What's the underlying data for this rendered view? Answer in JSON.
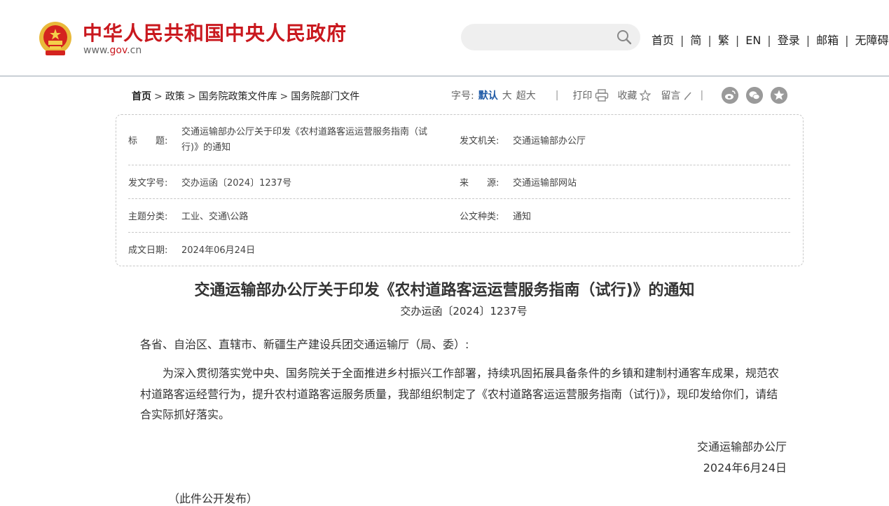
{
  "header": {
    "site_name": "中华人民共和国中央人民政府",
    "site_url_prefix": "www.",
    "site_url_highlight": "gov",
    "site_url_suffix": ".cn",
    "brand_color": "#c9181e",
    "nav": [
      "首页",
      "简",
      "繁",
      "EN",
      "登录",
      "邮箱",
      "无障碍"
    ],
    "separator": "|"
  },
  "breadcrumb": {
    "items": [
      "首页",
      "政策",
      "国务院政策文件库",
      "国务院部门文件"
    ],
    "separator": ">"
  },
  "tools": {
    "font_size_label": "字号:",
    "font_sizes": [
      "默认",
      "大",
      "超大"
    ],
    "separator": "|",
    "print_label": "打印",
    "favorite_label": "收藏",
    "comment_label": "留言",
    "share_icons": [
      "weibo-icon",
      "wechat-icon",
      "qzone-icon"
    ],
    "active_color": "#1f5aa6"
  },
  "info": {
    "title_label": "标　　题:",
    "title_line1": "交通运输部办公厅关于印发《农村道路客运运营服务指南（试",
    "title_line2": "行)》的通知",
    "issuer_label": "发文机关:",
    "issuer": "交通运输部办公厅",
    "doc_no_label": "发文字号:",
    "doc_no": "交办运函〔2024〕1237号",
    "source_label": "来　　源:",
    "source": "交通运输部网站",
    "subject_label": "主题分类:",
    "subject": "工业、交通\\公路",
    "type_label": "公文种类:",
    "type": "通知",
    "date_label": "成文日期:",
    "date": "2024年06月24日"
  },
  "article": {
    "title": "交通运输部办公厅关于印发《农村道路客运运营服务指南（试行)》的通知",
    "doc_no": "交办运函〔2024〕1237号",
    "salutation": "各省、自治区、直辖市、新疆生产建设兵团交通运输厅（局、委）:",
    "body": "为深入贯彻落实党中央、国务院关于全面推进乡村振兴工作部署，持续巩固拓展具备条件的乡镇和建制村通客车成果，规范农村道路客运经营行为，提升农村道路客运服务质量，我部组织制定了《农村道路客运运营服务指南（试行)》，现印发给你们，请结合实际抓好落实。",
    "signature": "交通运输部办公厅",
    "sign_date": "2024年6月24日",
    "note": "（此件公开发布）"
  }
}
